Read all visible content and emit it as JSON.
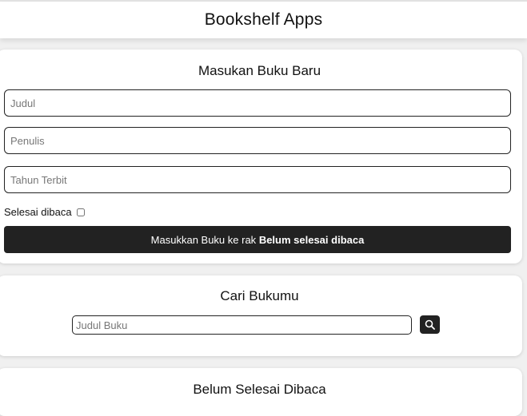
{
  "header": {
    "title": "Bookshelf Apps"
  },
  "add_book": {
    "title": "Masukan Buku Baru",
    "fields": {
      "judul": {
        "placeholder": "Judul",
        "value": ""
      },
      "penulis": {
        "placeholder": "Penulis",
        "value": ""
      },
      "tahun": {
        "placeholder": "Tahun Terbit",
        "value": ""
      }
    },
    "complete_label": "Selesai dibaca",
    "complete_checked": false,
    "submit": {
      "prefix": "Masukkan Buku ke rak",
      "shelf": "Belum selesai dibaca"
    }
  },
  "search": {
    "title": "Cari Bukumu",
    "placeholder": "Judul Buku",
    "button_icon": "search-icon"
  },
  "unread_shelf": {
    "title": "Belum Selesai Dibaca"
  },
  "colors": {
    "button_bg": "#222222",
    "card_bg": "#ffffff",
    "page_bg": "#f0f0f0"
  }
}
